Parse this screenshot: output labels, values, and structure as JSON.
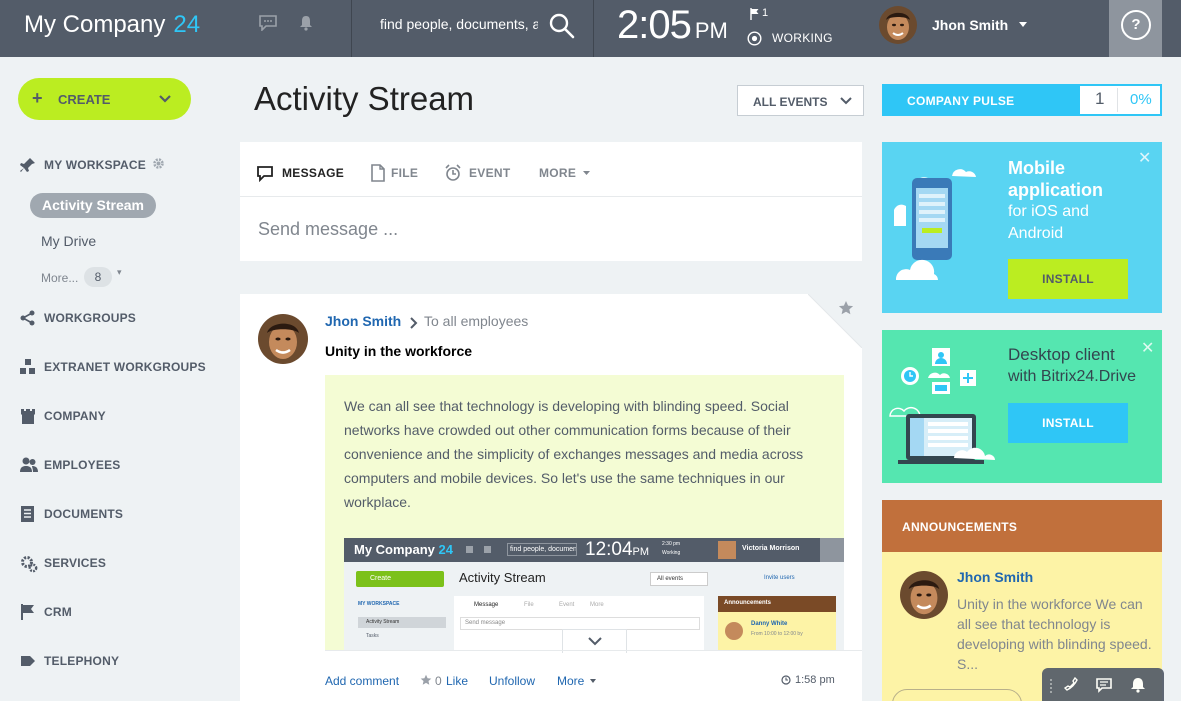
{
  "header": {
    "logo_name": "My Company",
    "logo_number": "24",
    "search_placeholder": "find people, documents, a",
    "clock_time": "2:05",
    "clock_ampm": "PM",
    "flag_count": "1",
    "work_status": "WORKING",
    "user_name": "Jhon Smith",
    "help_label": "?"
  },
  "sidebar": {
    "create_label": "CREATE",
    "workspace_label": "MY WORKSPACE",
    "active_item": "Activity Stream",
    "my_drive": "My Drive",
    "more_label": "More...",
    "more_count": "8",
    "items": [
      {
        "label": "WORKGROUPS",
        "icon": "share-icon"
      },
      {
        "label": "EXTRANET WORKGROUPS",
        "icon": "extranet-icon"
      },
      {
        "label": "COMPANY",
        "icon": "castle-icon"
      },
      {
        "label": "EMPLOYEES",
        "icon": "people-icon"
      },
      {
        "label": "DOCUMENTS",
        "icon": "document-icon"
      },
      {
        "label": "SERVICES",
        "icon": "gears-icon"
      },
      {
        "label": "CRM",
        "icon": "flag-icon"
      },
      {
        "label": "TELEPHONY",
        "icon": "tag-icon"
      }
    ]
  },
  "main": {
    "title": "Activity Stream",
    "filter_label": "ALL EVENTS",
    "composer": {
      "tabs": [
        {
          "label": "MESSAGE",
          "icon": "message-icon"
        },
        {
          "label": "FILE",
          "icon": "file-icon"
        },
        {
          "label": "EVENT",
          "icon": "alarm-icon"
        },
        {
          "label": "MORE",
          "icon": "caret-icon"
        }
      ],
      "placeholder": "Send message ..."
    },
    "post": {
      "author": "Jhon Smith",
      "audience": "To all employees",
      "title": "Unity in the workforce",
      "body": "We can all see that technology is developing with blinding speed. Social networks have crowded out other communication forms because of their convenience and the simplicity of exchanges messages and media across computers and mobile devices. So let's use the same techniques in our workplace.",
      "screenshot": {
        "logo_name": "My Company",
        "logo_number": "24",
        "search": "find people, documents,",
        "time": "12:04",
        "ampm": "PM",
        "mini_time": "2:30 pm",
        "mini_status": "Working",
        "user": "Victoria Morrison",
        "create": "Create",
        "title": "Activity Stream",
        "filter": "All events",
        "invite": "Invite users",
        "workspace": "MY WORKSPACE",
        "item1": "Activity Stream",
        "item2": "Tasks",
        "tab_message": "Message",
        "tab_file": "File",
        "tab_event": "Event",
        "tab_more": "More",
        "send": "Send message",
        "announcements": "Announcements",
        "ann_name": "Danny White",
        "ann_text": "From 10:00 to 12:00 by"
      },
      "actions": {
        "comment": "Add comment",
        "like_count": "0",
        "like": "Like",
        "unfollow": "Unfollow",
        "more": "More",
        "time": "1:58 pm"
      }
    }
  },
  "right": {
    "pulse_label": "COMPANY PULSE",
    "pulse_count": "1",
    "pulse_percent": "0%",
    "mobile": {
      "title1": "Mobile",
      "title2": "application",
      "sub1": "for iOS and",
      "sub2": "Android",
      "install": "INSTALL"
    },
    "desktop": {
      "title": "Desktop client",
      "sub": "with Bitrix24.Drive",
      "install": "INSTALL"
    },
    "announcements": {
      "header": "ANNOUNCEMENTS",
      "author": "Jhon Smith",
      "text": "Unity in the workforce We can all see that technology is developing with blinding speed. S..."
    }
  },
  "colors": {
    "header_bg": "#535c69",
    "accent_blue": "#2fc6f6",
    "create_green": "#bbed21",
    "mobile_card": "#59d4f2",
    "desktop_card": "#55e6b0",
    "announce_header": "#c1703c",
    "announce_bg": "#fdf3a6",
    "link": "#2067b0"
  }
}
